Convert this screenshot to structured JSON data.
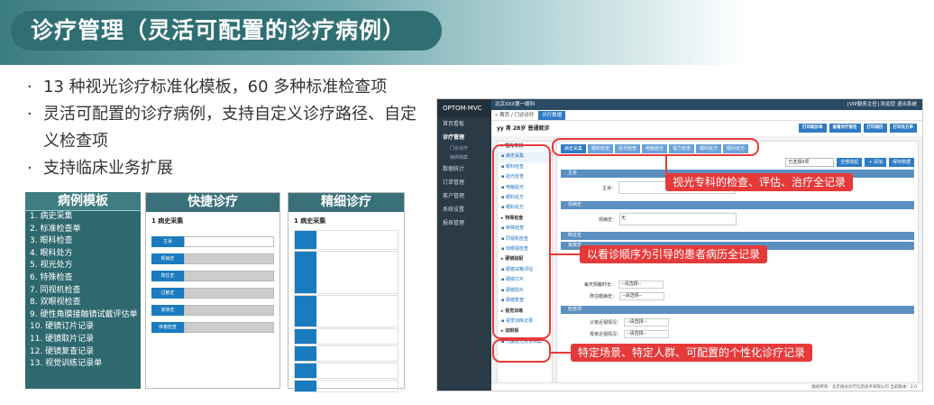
{
  "title": "诊疗管理（灵活可配置的诊疗病例）",
  "bullets": [
    "13 种视光诊疗标准化模板，60 多种标准检查项",
    "灵活可配置的诊疗病例，支持自定义诊疗路径、自定义检查项",
    "支持临床业务扩展"
  ],
  "bullet_mark": "·",
  "panels": {
    "templates": {
      "header": "病例模板",
      "items": [
        "1. 病史采集",
        "2. 标准检查单",
        "3. 眼科检查",
        "4. 眼科处方",
        "5. 视光处方",
        "6. 特殊检查",
        "7. 同视机检查",
        "8. 双眼视检查",
        "9. 硬性角膜接触镜试戴评估单",
        "10. 硬镜订片记录",
        "11. 硬镜取片记录",
        "12. 硬镜复查记录",
        "13. 视觉训练记录单"
      ]
    },
    "fast": {
      "header": "快捷诊疗",
      "section": "1 病史采集",
      "rows": [
        "主诉",
        "现病史",
        "既往史",
        "过敏史",
        "家族史",
        "体格检查"
      ]
    },
    "fine": {
      "header": "精细诊疗",
      "section": "1 病史采集"
    }
  },
  "app": {
    "logo": "OPTOM·MVC",
    "sidebar": [
      "首页看板",
      "诊疗管理",
      "门诊诊疗",
      "病例档案",
      "数据统计",
      "订单管理",
      "客户管理",
      "系统设置",
      "报表管理"
    ],
    "topbar_title": "北京XXX第一眼科",
    "topbar_right": "[VIP服务主任]  欢迎您  退出系统",
    "tabs_prefix": "« 首页 / 门诊诊疗",
    "active_tab": "诊疗数据",
    "patient_info": "yy  男  28岁  普通就诊",
    "patient_buttons": [
      "打印就诊单",
      "查看诊疗报告",
      "打印病历",
      "打印处方单"
    ],
    "tree": [
      {
        "label": "视光专科",
        "group": true
      },
      {
        "label": "病史采集",
        "active": true
      },
      {
        "label": "眼科检查"
      },
      {
        "label": "验光检查"
      },
      {
        "label": "电脑验光"
      },
      {
        "label": "眼科处方"
      },
      {
        "label": "眼科处方"
      },
      {
        "label": "特殊检查",
        "group": true
      },
      {
        "label": "特殊检查"
      },
      {
        "label": "同视机检查"
      },
      {
        "label": "双眼视检查"
      },
      {
        "label": "硬镜验配",
        "group": true
      },
      {
        "label": "硬镜试戴评估"
      },
      {
        "label": "硬镜订片"
      },
      {
        "label": "硬镜取片"
      },
      {
        "label": "硬镜复查"
      },
      {
        "label": "视觉训练",
        "group": true
      },
      {
        "label": "视觉训练记录"
      },
      {
        "label": "双眼视",
        "group": true
      },
      {
        "label": "儿童屈光发育档案"
      }
    ],
    "steps": [
      "病史采集",
      "眼科检查",
      "验光检查",
      "电脑验光",
      "视力检查",
      "眼科处方",
      "眼科处方"
    ],
    "select_value": "已选择0项",
    "tool_buttons": [
      "全部收起",
      "+ 添加",
      "保存数据"
    ],
    "sections": [
      "主诉",
      "现病史",
      "既往史",
      "家族史",
      "检查项"
    ],
    "fields": {
      "chief_label": "主诉：",
      "hpi_label": "现病史：",
      "hpi_value": "无",
      "wear_label": "每天佩戴时长：",
      "wear_value": "--请选择--",
      "hist_label": "既往眼病史：",
      "hist_value": "--请选择--",
      "fam1_label": "父亲近视情况：",
      "fam1_value": "--请选择--",
      "fam2_label": "母亲近视情况：",
      "fam2_value": "--请选择--"
    },
    "footer": "版权所有：北京视光诊疗信息技术有限公司  当前版本：2.0"
  },
  "callouts": [
    "视光专科的检查、评估、治疗全记录",
    "以看诊顺序为引导的患者病历全记录",
    "特定场景、特定人群、可配置的个性化诊疗记录"
  ],
  "colors": {
    "accent": "#2f6f74",
    "highlight": "#e63a3a",
    "blue": "#2f7bc4"
  }
}
